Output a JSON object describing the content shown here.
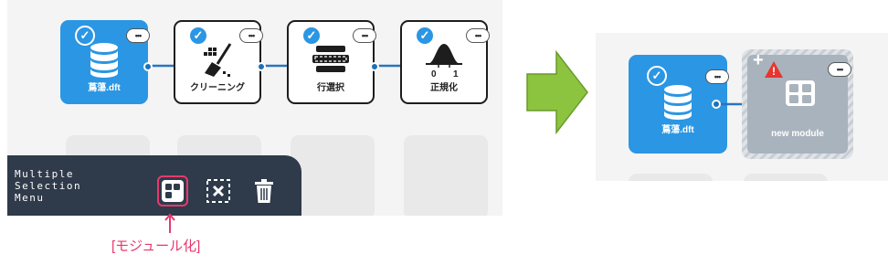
{
  "before": {
    "modules": [
      {
        "label": "蔦蕩.dft",
        "icon": "database-icon",
        "style": "blue",
        "menu": "•••"
      },
      {
        "label": "クリーニング",
        "icon": "broom-icon",
        "style": "white",
        "menu": "•••"
      },
      {
        "label": "行選択",
        "icon": "row-select-icon",
        "style": "white",
        "menu": "•••"
      },
      {
        "label": "正規化",
        "icon": "normal-distribution-icon",
        "style": "white",
        "menu": "•••",
        "axis_ticks": [
          "0",
          "1"
        ]
      }
    ],
    "check_glyph": "✓"
  },
  "selection_menu": {
    "title": "Multiple\nSelection\nMenu",
    "buttons": [
      {
        "name": "modularize",
        "icon": "modularize-icon",
        "highlighted": true
      },
      {
        "name": "deselect",
        "icon": "deselect-icon",
        "highlighted": false
      },
      {
        "name": "delete",
        "icon": "trash-icon",
        "highlighted": false
      }
    ]
  },
  "caption": "[モジュール化]",
  "after": {
    "source": {
      "label": "蔦蕩.dft",
      "icon": "database-icon",
      "menu": "•••"
    },
    "new_module": {
      "label": "new module",
      "icon": "module-icon",
      "menu": "•••",
      "warning_glyph": "!",
      "plus_glyph": "+"
    }
  },
  "colors": {
    "accent_blue": "#2b96e3",
    "menu_bg": "#2f3a4a",
    "highlight": "#e8386d",
    "arrow_green": "#8cc43f",
    "warning_red": "#e8352e"
  }
}
